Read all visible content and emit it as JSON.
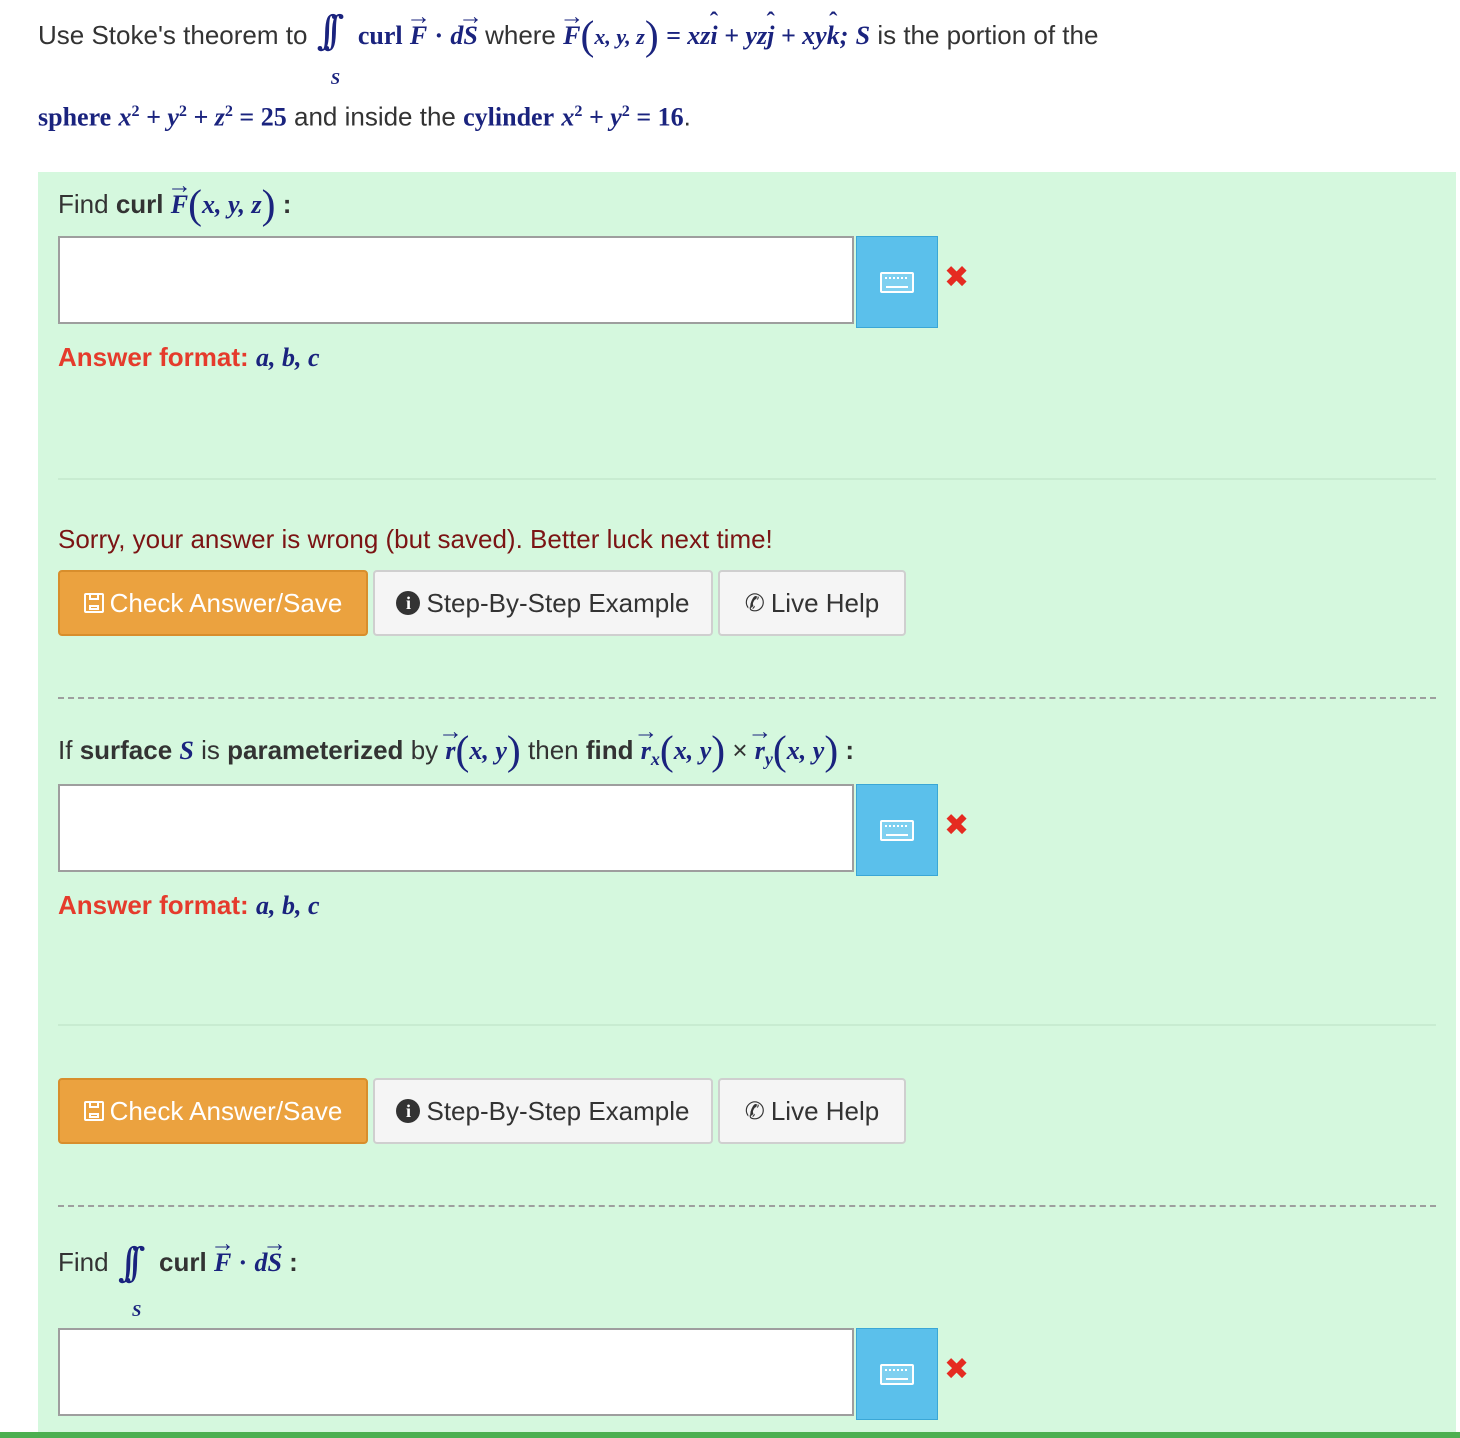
{
  "problem": {
    "prefix": "Use Stoke's theorem to",
    "integral_sub": "S",
    "curl_word": "curl",
    "F": "F",
    "dot": "·",
    "dS_d": "d",
    "dS_S": "S",
    "where_word": "where",
    "F_args": "x, y, z",
    "eq_rhs_part1": "= xz",
    "i_hat": "i",
    "eq_rhs_part2": " + yz",
    "j_hat": "j",
    "eq_rhs_part3": " + xy",
    "k_hat": "k",
    "after_eq": ";",
    "S_var": "S",
    "portion_text": "is the portion of the",
    "sphere_word": "sphere",
    "sphere_eq_part1": "x",
    "sphere_eq_part2": " + y",
    "sphere_eq_part3": " + z",
    "sphere_eq_part4": " = 25",
    "inside_text": "and inside the",
    "cylinder_word": "cylinder",
    "cyl_eq_part1": "x",
    "cyl_eq_part2": " + y",
    "cyl_eq_part3": " = 16",
    "period": ".",
    "sq": "2"
  },
  "q1": {
    "find_word": "Find",
    "curl_word": "curl",
    "F": "F",
    "args": "x, y, z",
    "colon": ":",
    "answer_value": "",
    "format_label": "Answer format:",
    "format_value": "a, b, c",
    "wrong_mark": "✖"
  },
  "feedback": "Sorry, your answer is wrong (but saved). Better luck next time!",
  "buttons1": {
    "check": "Check Answer/Save",
    "step": "Step-By-Step Example",
    "help": "Live Help"
  },
  "q2": {
    "if_word": "If",
    "surface_word": "surface",
    "S": "S",
    "is_word": "is",
    "param_word": "parameterized",
    "by_word": "by",
    "r": "r",
    "r_args": "x, y",
    "then_word": "then",
    "find_word": "find",
    "rx_sub": "x",
    "ry_sub": "y",
    "cross": "×",
    "rx_args": "x, y",
    "ry_args": "x, y",
    "colon": ":",
    "answer_value": "",
    "format_label": "Answer format:",
    "format_value": "a, b, c",
    "wrong_mark": "✖"
  },
  "buttons2": {
    "check": "Check Answer/Save",
    "step": "Step-By-Step Example",
    "help": "Live Help"
  },
  "q3": {
    "find_word": "Find",
    "integral_sub": "S",
    "curl_word": "curl",
    "F": "F",
    "dot": "·",
    "d": "d",
    "S": "S",
    "colon": ":",
    "answer_value": "",
    "wrong_mark": "✖"
  },
  "colors": {
    "panel": "#d5f8de",
    "check_button": "#eba23f",
    "keyboard_button": "#5bc0eb",
    "error": "#e52b21",
    "math": "#1a237e"
  }
}
